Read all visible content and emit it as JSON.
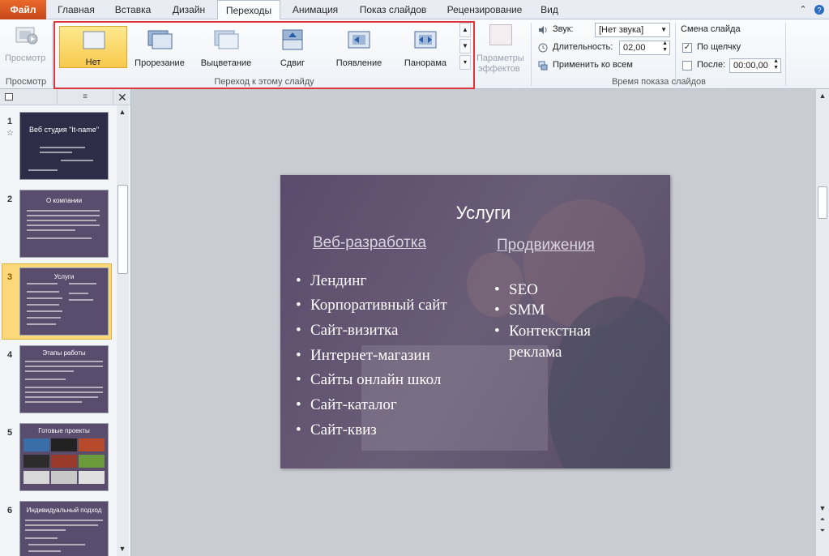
{
  "tabs": [
    "Файл",
    "Главная",
    "Вставка",
    "Дизайн",
    "Переходы",
    "Анимация",
    "Показ слайдов",
    "Рецензирование",
    "Вид"
  ],
  "ribbon": {
    "preview": {
      "label": "Просмотр",
      "group": "Просмотр"
    },
    "transitions": {
      "items": [
        "Нет",
        "Прорезание",
        "Выцветание",
        "Сдвиг",
        "Появление",
        "Панорама"
      ],
      "selected": "Нет",
      "group": "Переход к этому слайду"
    },
    "effects": {
      "line1": "Параметры",
      "line2": "эффектов"
    },
    "timing": {
      "sound_label": "Звук:",
      "sound_value": "[Нет звука]",
      "duration_label": "Длительность:",
      "duration_value": "02,00",
      "apply_all": "Применить ко всем",
      "advance_title": "Смена слайда",
      "on_click": "По щелчку",
      "after": "После:",
      "after_value": "00:00,00",
      "group": "Время показа слайдов"
    }
  },
  "slides_panel": {
    "slides": [
      {
        "num": "1",
        "title": "Веб студия \"It-name\""
      },
      {
        "num": "2",
        "title": "О компании"
      },
      {
        "num": "3",
        "title": "Услуги"
      },
      {
        "num": "4",
        "title": "Этапы работы"
      },
      {
        "num": "5",
        "title": "Готовые проекты"
      },
      {
        "num": "6",
        "title": "Индивидуальный подход"
      }
    ],
    "selected": "3"
  },
  "slide": {
    "title": "Услуги",
    "left_heading": "Веб-разработка",
    "right_heading": "Продвижения",
    "left_items": [
      "Лендинг",
      "Корпоративный сайт",
      "Сайт-визитка",
      "Интернет-магазин",
      "Сайты онлайн школ",
      "Сайт-каталог",
      "Сайт-квиз"
    ],
    "right_items": [
      "SEO",
      "SMM",
      "Контекстная",
      "реклама"
    ]
  },
  "colors": {
    "accent_file": "#d2521f",
    "selected_transition": "#f8c94c",
    "annotation": "#d9363e"
  }
}
